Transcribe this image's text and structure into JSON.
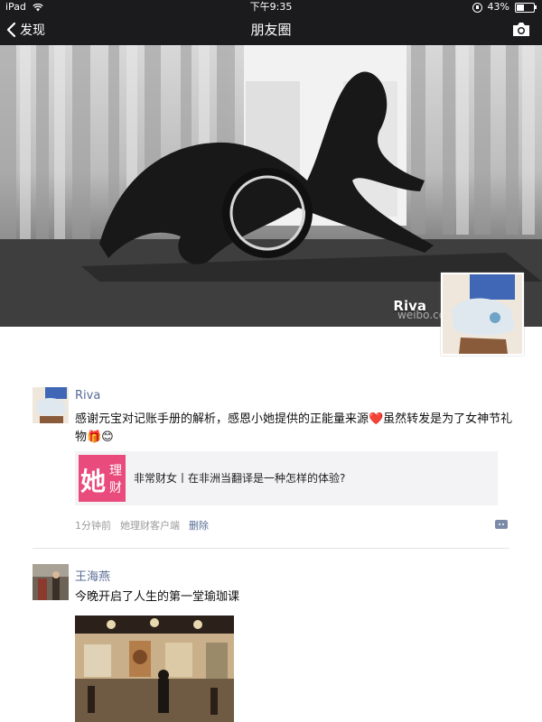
{
  "status_bar": {
    "device": "iPad",
    "time": "下午9:35",
    "battery": "43%",
    "battery_level": 0.43
  },
  "nav": {
    "back_label": "发现",
    "title": "朋友圈"
  },
  "cover": {
    "username": "Riva",
    "watermark": "weibo.com/u"
  },
  "posts": [
    {
      "username": "Riva",
      "text": "感谢元宝对记账手册的解析，感恩小她提供的正能量来源❤️虽然转发是为了女神节礼物🎁😊",
      "share": {
        "logo_text_1": "她",
        "logo_text_2": "理",
        "logo_text_3": "财",
        "title": "非常财女丨在非洲当翻译是一种怎样的体验?"
      },
      "time": "1分钟前",
      "source": "她理财客户端",
      "delete_label": "删除"
    },
    {
      "username": "王海燕",
      "text": "今晚开启了人生的第一堂瑜珈课"
    }
  ],
  "colors": {
    "bar": "#1b1b1d",
    "name_link": "#576b95",
    "share_logo": "#e94c7c"
  }
}
